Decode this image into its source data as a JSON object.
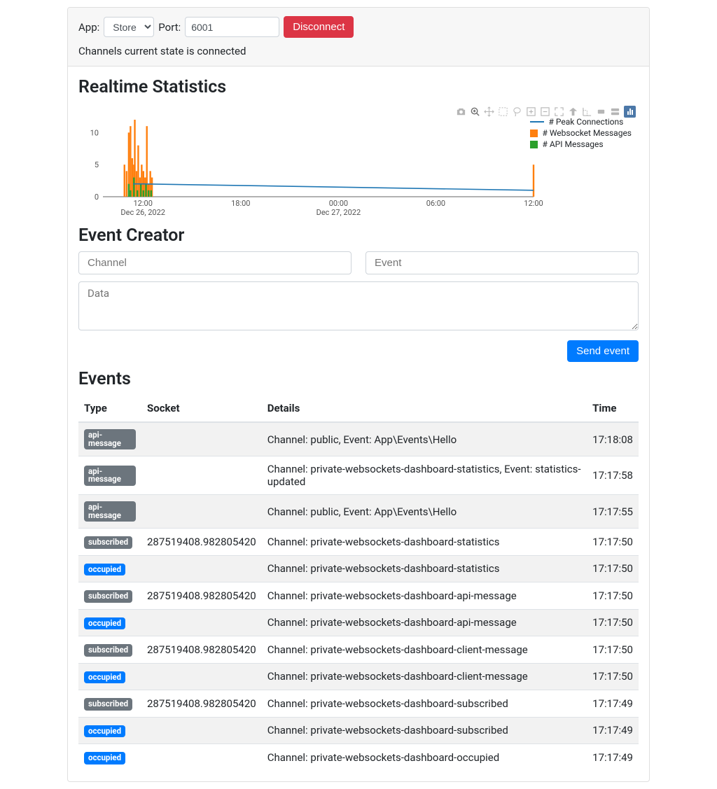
{
  "header": {
    "app_label": "App:",
    "app_selected": "Store",
    "port_label": "Port:",
    "port_value": "6001",
    "disconnect_label": "Disconnect",
    "status_text": "Channels current state is connected"
  },
  "stats": {
    "title": "Realtime Statistics",
    "legend": {
      "peak": "# Peak Connections",
      "ws": "# Websocket Messages",
      "api": "# API Messages"
    },
    "toolbar_icons": [
      "camera",
      "zoom",
      "pan",
      "box-select",
      "lasso",
      "zoom-in",
      "zoom-out",
      "autoscale",
      "reset",
      "spike",
      "hover-closest",
      "hover-compare",
      "plotly-logo"
    ]
  },
  "chart_data": {
    "type": "line",
    "xlabel": "",
    "ylabel": "",
    "ylim": [
      0,
      12
    ],
    "x_ticks": [
      "12:00",
      "18:00",
      "00:00",
      "06:00",
      "12:00"
    ],
    "x_range_labels": [
      "Dec 26, 2022",
      "Dec 27, 2022"
    ],
    "y_ticks": [
      0,
      5,
      10
    ],
    "series": [
      {
        "name": "# Peak Connections",
        "type": "line",
        "color": "#1f77b4",
        "points": [
          [
            0.07,
            2
          ],
          [
            0.09,
            2
          ],
          [
            1.0,
            1
          ]
        ]
      },
      {
        "name": "# Websocket Messages",
        "type": "area",
        "color": "#ff7f0e",
        "bars": [
          [
            0.05,
            5
          ],
          [
            0.055,
            4
          ],
          [
            0.06,
            10
          ],
          [
            0.064,
            11
          ],
          [
            0.068,
            6
          ],
          [
            0.072,
            5
          ],
          [
            0.074,
            12
          ],
          [
            0.078,
            4
          ],
          [
            0.082,
            8
          ],
          [
            0.086,
            3
          ],
          [
            0.09,
            5
          ],
          [
            0.094,
            4
          ],
          [
            0.098,
            3
          ],
          [
            0.102,
            11
          ],
          [
            0.106,
            2
          ],
          [
            0.11,
            4
          ],
          [
            0.114,
            3
          ],
          [
            1.0,
            5
          ]
        ]
      },
      {
        "name": "# API Messages",
        "type": "area",
        "color": "#2ca02c",
        "bars": [
          [
            0.06,
            2
          ],
          [
            0.064,
            1
          ],
          [
            0.072,
            3
          ],
          [
            0.08,
            1
          ],
          [
            0.088,
            2
          ],
          [
            0.094,
            1
          ],
          [
            0.1,
            2
          ],
          [
            0.106,
            1
          ],
          [
            0.112,
            1
          ]
        ]
      }
    ]
  },
  "creator": {
    "title": "Event Creator",
    "channel_placeholder": "Channel",
    "event_placeholder": "Event",
    "data_placeholder": "Data",
    "send_label": "Send event"
  },
  "events": {
    "title": "Events",
    "headers": {
      "type": "Type",
      "socket": "Socket",
      "details": "Details",
      "time": "Time"
    },
    "rows": [
      {
        "badge": "api-message",
        "badge_style": "secondary",
        "socket": "",
        "details": "Channel: public, Event: App\\Events\\Hello",
        "time": "17:18:08"
      },
      {
        "badge": "api-message",
        "badge_style": "secondary",
        "socket": "",
        "details": "Channel: private-websockets-dashboard-statistics, Event: statistics-updated",
        "time": "17:17:58"
      },
      {
        "badge": "api-message",
        "badge_style": "secondary",
        "socket": "",
        "details": "Channel: public, Event: App\\Events\\Hello",
        "time": "17:17:55"
      },
      {
        "badge": "subscribed",
        "badge_style": "secondary",
        "socket": "287519408.982805420",
        "details": "Channel: private-websockets-dashboard-statistics",
        "time": "17:17:50"
      },
      {
        "badge": "occupied",
        "badge_style": "primary",
        "socket": "",
        "details": "Channel: private-websockets-dashboard-statistics",
        "time": "17:17:50"
      },
      {
        "badge": "subscribed",
        "badge_style": "secondary",
        "socket": "287519408.982805420",
        "details": "Channel: private-websockets-dashboard-api-message",
        "time": "17:17:50"
      },
      {
        "badge": "occupied",
        "badge_style": "primary",
        "socket": "",
        "details": "Channel: private-websockets-dashboard-api-message",
        "time": "17:17:50"
      },
      {
        "badge": "subscribed",
        "badge_style": "secondary",
        "socket": "287519408.982805420",
        "details": "Channel: private-websockets-dashboard-client-message",
        "time": "17:17:50"
      },
      {
        "badge": "occupied",
        "badge_style": "primary",
        "socket": "",
        "details": "Channel: private-websockets-dashboard-client-message",
        "time": "17:17:50"
      },
      {
        "badge": "subscribed",
        "badge_style": "secondary",
        "socket": "287519408.982805420",
        "details": "Channel: private-websockets-dashboard-subscribed",
        "time": "17:17:49"
      },
      {
        "badge": "occupied",
        "badge_style": "primary",
        "socket": "",
        "details": "Channel: private-websockets-dashboard-subscribed",
        "time": "17:17:49"
      },
      {
        "badge": "occupied",
        "badge_style": "primary",
        "socket": "",
        "details": "Channel: private-websockets-dashboard-occupied",
        "time": "17:17:49"
      }
    ]
  }
}
